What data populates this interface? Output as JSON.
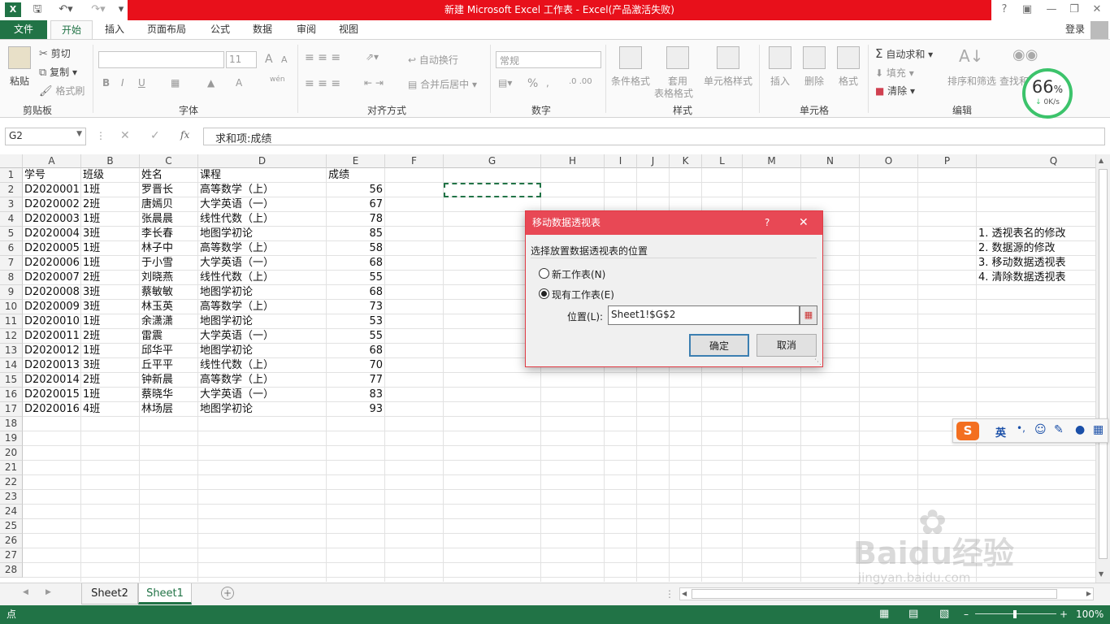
{
  "window": {
    "title": "新建 Microsoft Excel 工作表 -  Excel(产品激活失败)",
    "help": "?"
  },
  "tabs": [
    "文件",
    "开始",
    "插入",
    "页面布局",
    "公式",
    "数据",
    "审阅",
    "视图"
  ],
  "login": "登录",
  "ribbon": {
    "clipboard": {
      "paste": "粘贴",
      "cut": "剪切",
      "copy": "复制",
      "format_painter": "格式刷",
      "label": "剪贴板"
    },
    "font": {
      "size": "11",
      "bold": "B",
      "italic": "I",
      "underline": "U",
      "grow": "A",
      "shrink": "A",
      "font_color": "A",
      "wen": "wén",
      "label": "字体"
    },
    "align": {
      "wrap": "自动换行",
      "merge": "合并后居中",
      "label": "对齐方式"
    },
    "number": {
      "format": "常规",
      "percent": "%",
      "label": "数字"
    },
    "styles": {
      "cond": "条件格式",
      "table": "套用",
      "table2": "表格格式",
      "cell": "单元格样式",
      "label": "样式"
    },
    "cells": {
      "insert": "插入",
      "delete": "删除",
      "format": "格式",
      "label": "单元格"
    },
    "editing": {
      "autosum": "自动求和",
      "fill": "填充",
      "clear": "清除",
      "sort": "排序和筛选",
      "find": "查找和",
      "label": "编辑"
    }
  },
  "formula_bar": {
    "name_box": "G2",
    "fx": "fx",
    "formula": "求和项:成绩"
  },
  "columns": [
    "A",
    "B",
    "C",
    "D",
    "E",
    "F",
    "G",
    "H",
    "I",
    "J",
    "K",
    "L",
    "M",
    "N",
    "O",
    "P",
    "Q"
  ],
  "rows": [
    "1",
    "2",
    "3",
    "4",
    "5",
    "6",
    "7",
    "8",
    "9",
    "10",
    "11",
    "12",
    "13",
    "14",
    "15",
    "16",
    "17",
    "18",
    "19",
    "20",
    "21",
    "22",
    "23",
    "24",
    "25",
    "26",
    "27",
    "28"
  ],
  "table": {
    "headers": [
      "学号",
      "班级",
      "姓名",
      "课程",
      "成绩"
    ],
    "data": [
      [
        "D2020001",
        "1班",
        "罗晋长",
        "高等数学（上）",
        "56"
      ],
      [
        "D2020002",
        "2班",
        "唐嫣贝",
        "大学英语（一）",
        "67"
      ],
      [
        "D2020003",
        "1班",
        "张晨晨",
        "线性代数（上）",
        "78"
      ],
      [
        "D2020004",
        "3班",
        "李长春",
        "地图学初论",
        "85"
      ],
      [
        "D2020005",
        "1班",
        "林子中",
        "高等数学（上）",
        "58"
      ],
      [
        "D2020006",
        "1班",
        "于小雪",
        "大学英语（一）",
        "68"
      ],
      [
        "D2020007",
        "2班",
        "刘晓燕",
        "线性代数（上）",
        "55"
      ],
      [
        "D2020008",
        "3班",
        "蔡敏敏",
        "地图学初论",
        "68"
      ],
      [
        "D2020009",
        "3班",
        "林玉英",
        "高等数学（上）",
        "73"
      ],
      [
        "D2020010",
        "1班",
        "余潇潇",
        "地图学初论",
        "53"
      ],
      [
        "D2020011",
        "2班",
        "雷震",
        "大学英语（一）",
        "55"
      ],
      [
        "D2020012",
        "1班",
        "邱华平",
        "地图学初论",
        "68"
      ],
      [
        "D2020013",
        "3班",
        "丘平平",
        "线性代数（上）",
        "70"
      ],
      [
        "D2020014",
        "2班",
        "钟新晨",
        "高等数学（上）",
        "77"
      ],
      [
        "D2020015",
        "1班",
        "蔡晓华",
        "大学英语（一）",
        "83"
      ],
      [
        "D2020016",
        "4班",
        "林场层",
        "地图学初论",
        "93"
      ]
    ]
  },
  "notes": [
    "1. 透视表名的修改",
    "2. 数据源的修改",
    "3. 移动数据透视表",
    "4. 清除数据透视表"
  ],
  "dialog": {
    "title": "移动数据透视表",
    "help": "?",
    "prompt": "选择放置数据透视表的位置",
    "opt_new": "新工作表(N)",
    "opt_existing": "现有工作表(E)",
    "location_label": "位置(L):",
    "location_value": "Sheet1!$G$2",
    "ok": "确定",
    "cancel": "取消"
  },
  "sheets": [
    "Sheet2",
    "Sheet1"
  ],
  "status": {
    "mode": "点",
    "zoom": "100%"
  },
  "ime": {
    "lang": "英",
    "punct": "•,"
  },
  "speed": {
    "percent": "66",
    "unit": "%",
    "rate": "0K/s"
  },
  "watermark": {
    "brand": "Baidu经验",
    "url": "jingyan.baidu.com"
  },
  "colors": {
    "excel_green": "#217346",
    "title_red": "#e8101b",
    "dialog_red": "#e84855",
    "selection": "#217346"
  }
}
